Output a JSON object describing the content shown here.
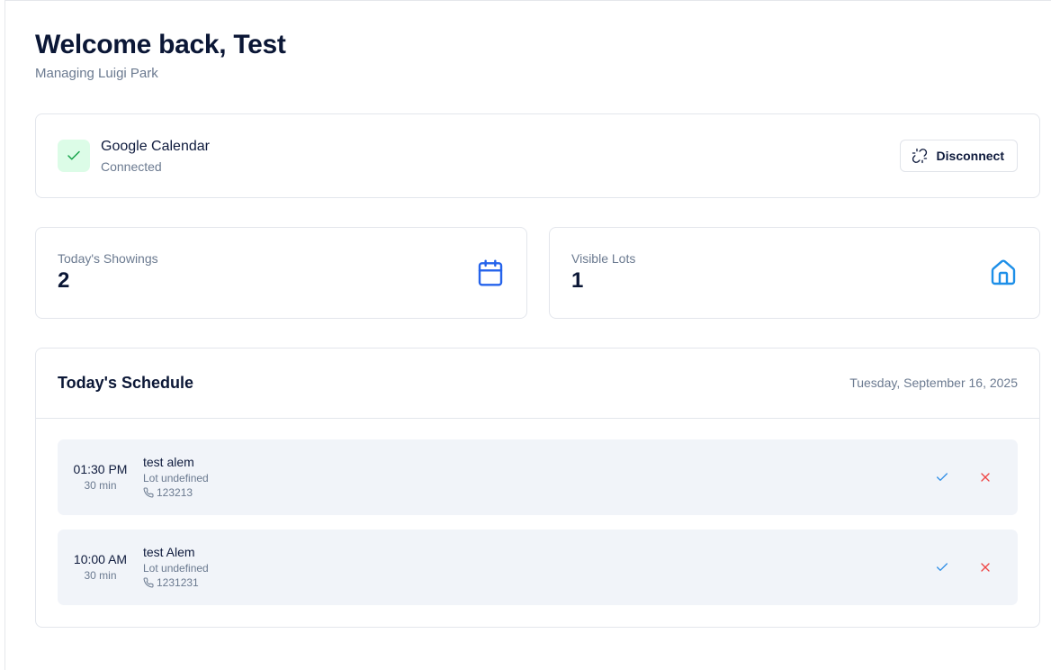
{
  "header": {
    "title": "Welcome back, Test",
    "subtitle": "Managing Luigi Park"
  },
  "calendar": {
    "name": "Google Calendar",
    "status": "Connected",
    "disconnect_label": "Disconnect",
    "check_icon": "check-icon",
    "unlink_icon": "unlink-icon"
  },
  "stats": [
    {
      "label": "Today's Showings",
      "value": "2",
      "icon": "calendar-icon"
    },
    {
      "label": "Visible Lots",
      "value": "1",
      "icon": "home-icon"
    }
  ],
  "schedule": {
    "title": "Today's Schedule",
    "date": "Tuesday, September 16, 2025",
    "items": [
      {
        "time": "01:30 PM",
        "duration": "30 min",
        "name": "test alem",
        "lot": "Lot undefined",
        "phone": "123213"
      },
      {
        "time": "10:00 AM",
        "duration": "30 min",
        "name": "test Alem",
        "lot": "Lot undefined",
        "phone": "1231231"
      }
    ]
  },
  "colors": {
    "accent_blue": "#2563eb",
    "success_green": "#16a34a",
    "success_bg": "#dcfce7",
    "danger_red": "#ef4444"
  }
}
